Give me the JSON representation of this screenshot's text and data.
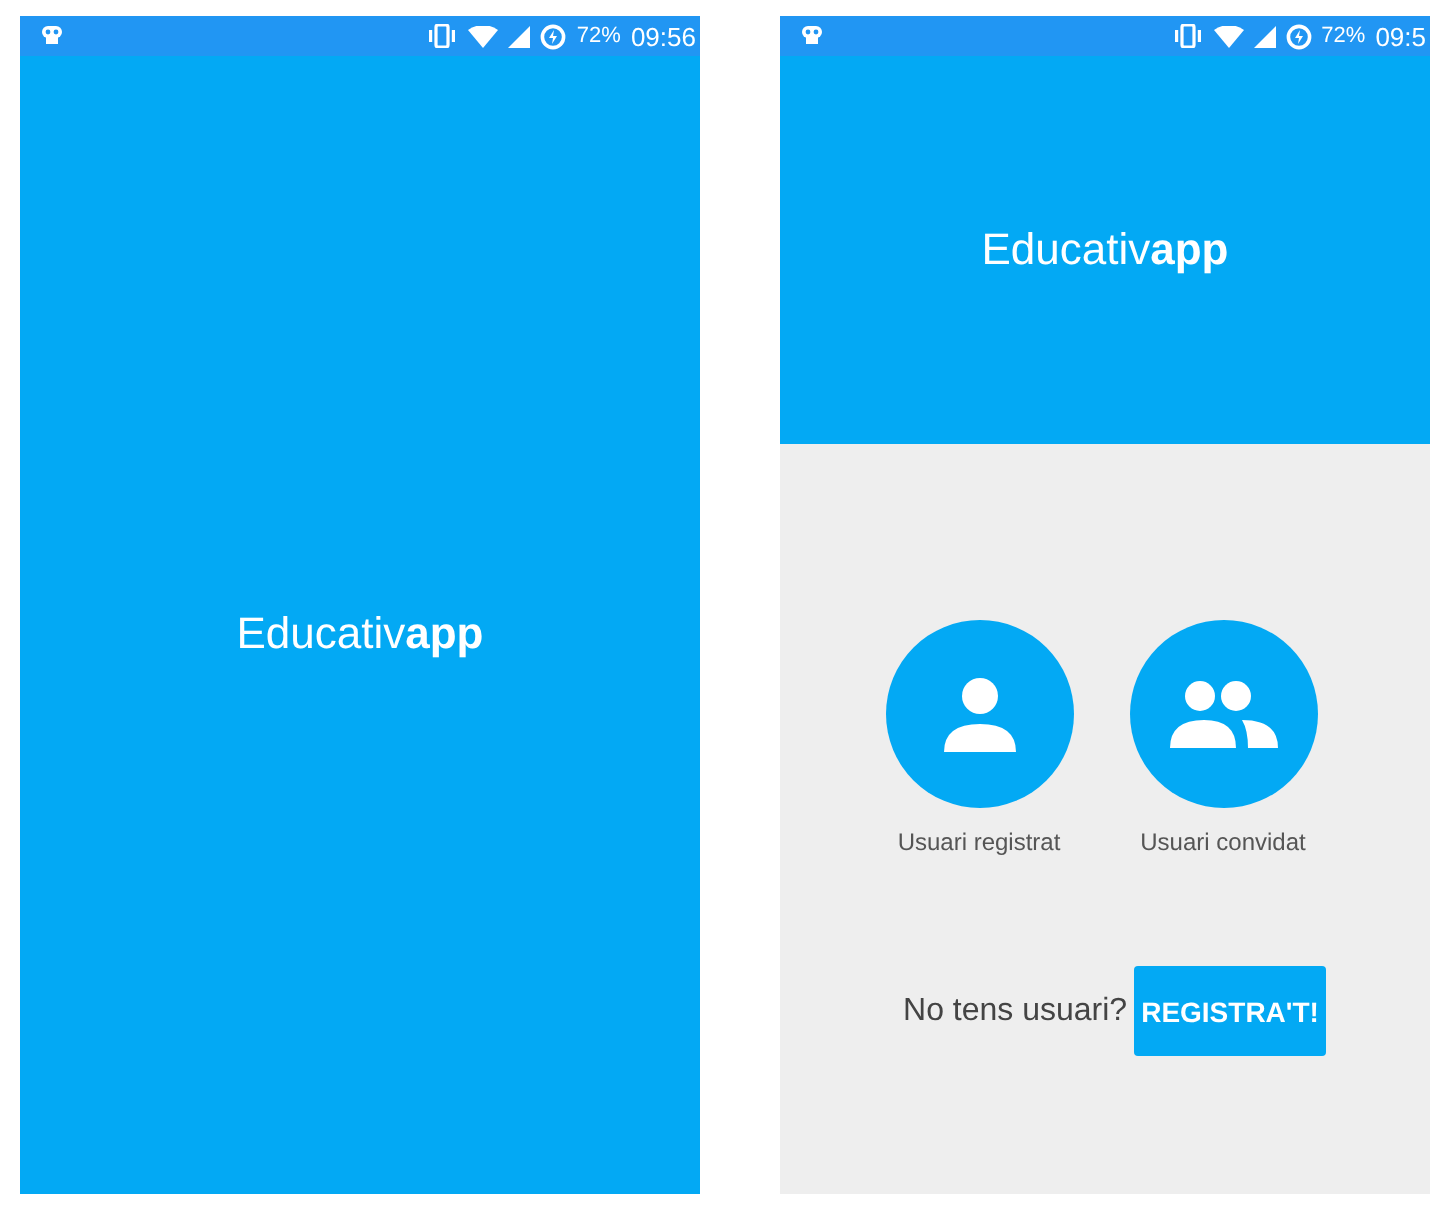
{
  "screens": [
    {
      "kind": "splash",
      "status_bar": {
        "battery": "72%",
        "time": "09:56"
      },
      "title": "Educativ**app**"
    },
    {
      "kind": "login",
      "status_bar": {
        "battery": "72%",
        "time": "09:5"
      },
      "title": "Educativ**app**",
      "options": [
        {
          "kind": "single",
          "label": "Usuari registrat"
        },
        {
          "kind": "group",
          "label": "Usuari convidat"
        }
      ],
      "register": {
        "prompt": "No tens usuari?",
        "button": "REGISTRA'T!"
      }
    }
  ]
}
